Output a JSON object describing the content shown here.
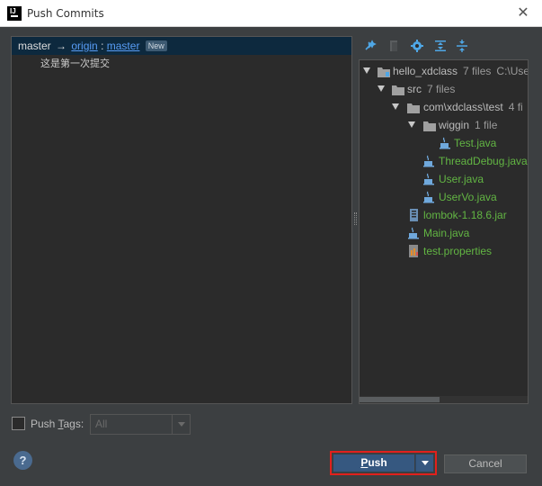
{
  "window": {
    "title": "Push Commits",
    "app_icon_text": "IJ"
  },
  "commits": {
    "branch": {
      "local": "master",
      "arrow": "→",
      "remote": "origin",
      "separator": ":",
      "remote_branch": "master",
      "badge": "New"
    },
    "items": [
      {
        "message": "这是第一次提交"
      }
    ]
  },
  "toolbar": {
    "icons": [
      "expand-all-icon",
      "collapse-icon",
      "settings-icon",
      "expand-tree-icon",
      "collapse-tree-icon"
    ]
  },
  "tree": {
    "root": {
      "name": "hello_xdclass",
      "count": "7 files",
      "path": "C:\\Use"
    },
    "src": {
      "name": "src",
      "count": "7 files"
    },
    "package": {
      "name": "com\\xdclass\\test",
      "count": "4 fi"
    },
    "wiggin": {
      "name": "wiggin",
      "count": "1 file"
    },
    "files": {
      "test_java": "Test.java",
      "thread_debug": "ThreadDebug.java",
      "user_java": "User.java",
      "user_vo": "UserVo.java",
      "lombok": "lombok-1.18.6.jar",
      "main_java": "Main.java",
      "test_properties": "test.properties"
    }
  },
  "footer": {
    "push_tags_label_pre": "Push ",
    "push_tags_label_u": "T",
    "push_tags_label_post": "ags:",
    "push_tags_checked": false,
    "tags_select_value": "All",
    "help": "?",
    "push_label_u": "P",
    "push_label_rest": "ush",
    "cancel_label": "Cancel"
  },
  "colors": {
    "background": "#3c3f41",
    "panel": "#2b2b2b",
    "selection": "#0d293e",
    "link": "#589df6",
    "new_file": "#62b543",
    "primary_button": "#365880",
    "highlight": "#e2201c"
  }
}
